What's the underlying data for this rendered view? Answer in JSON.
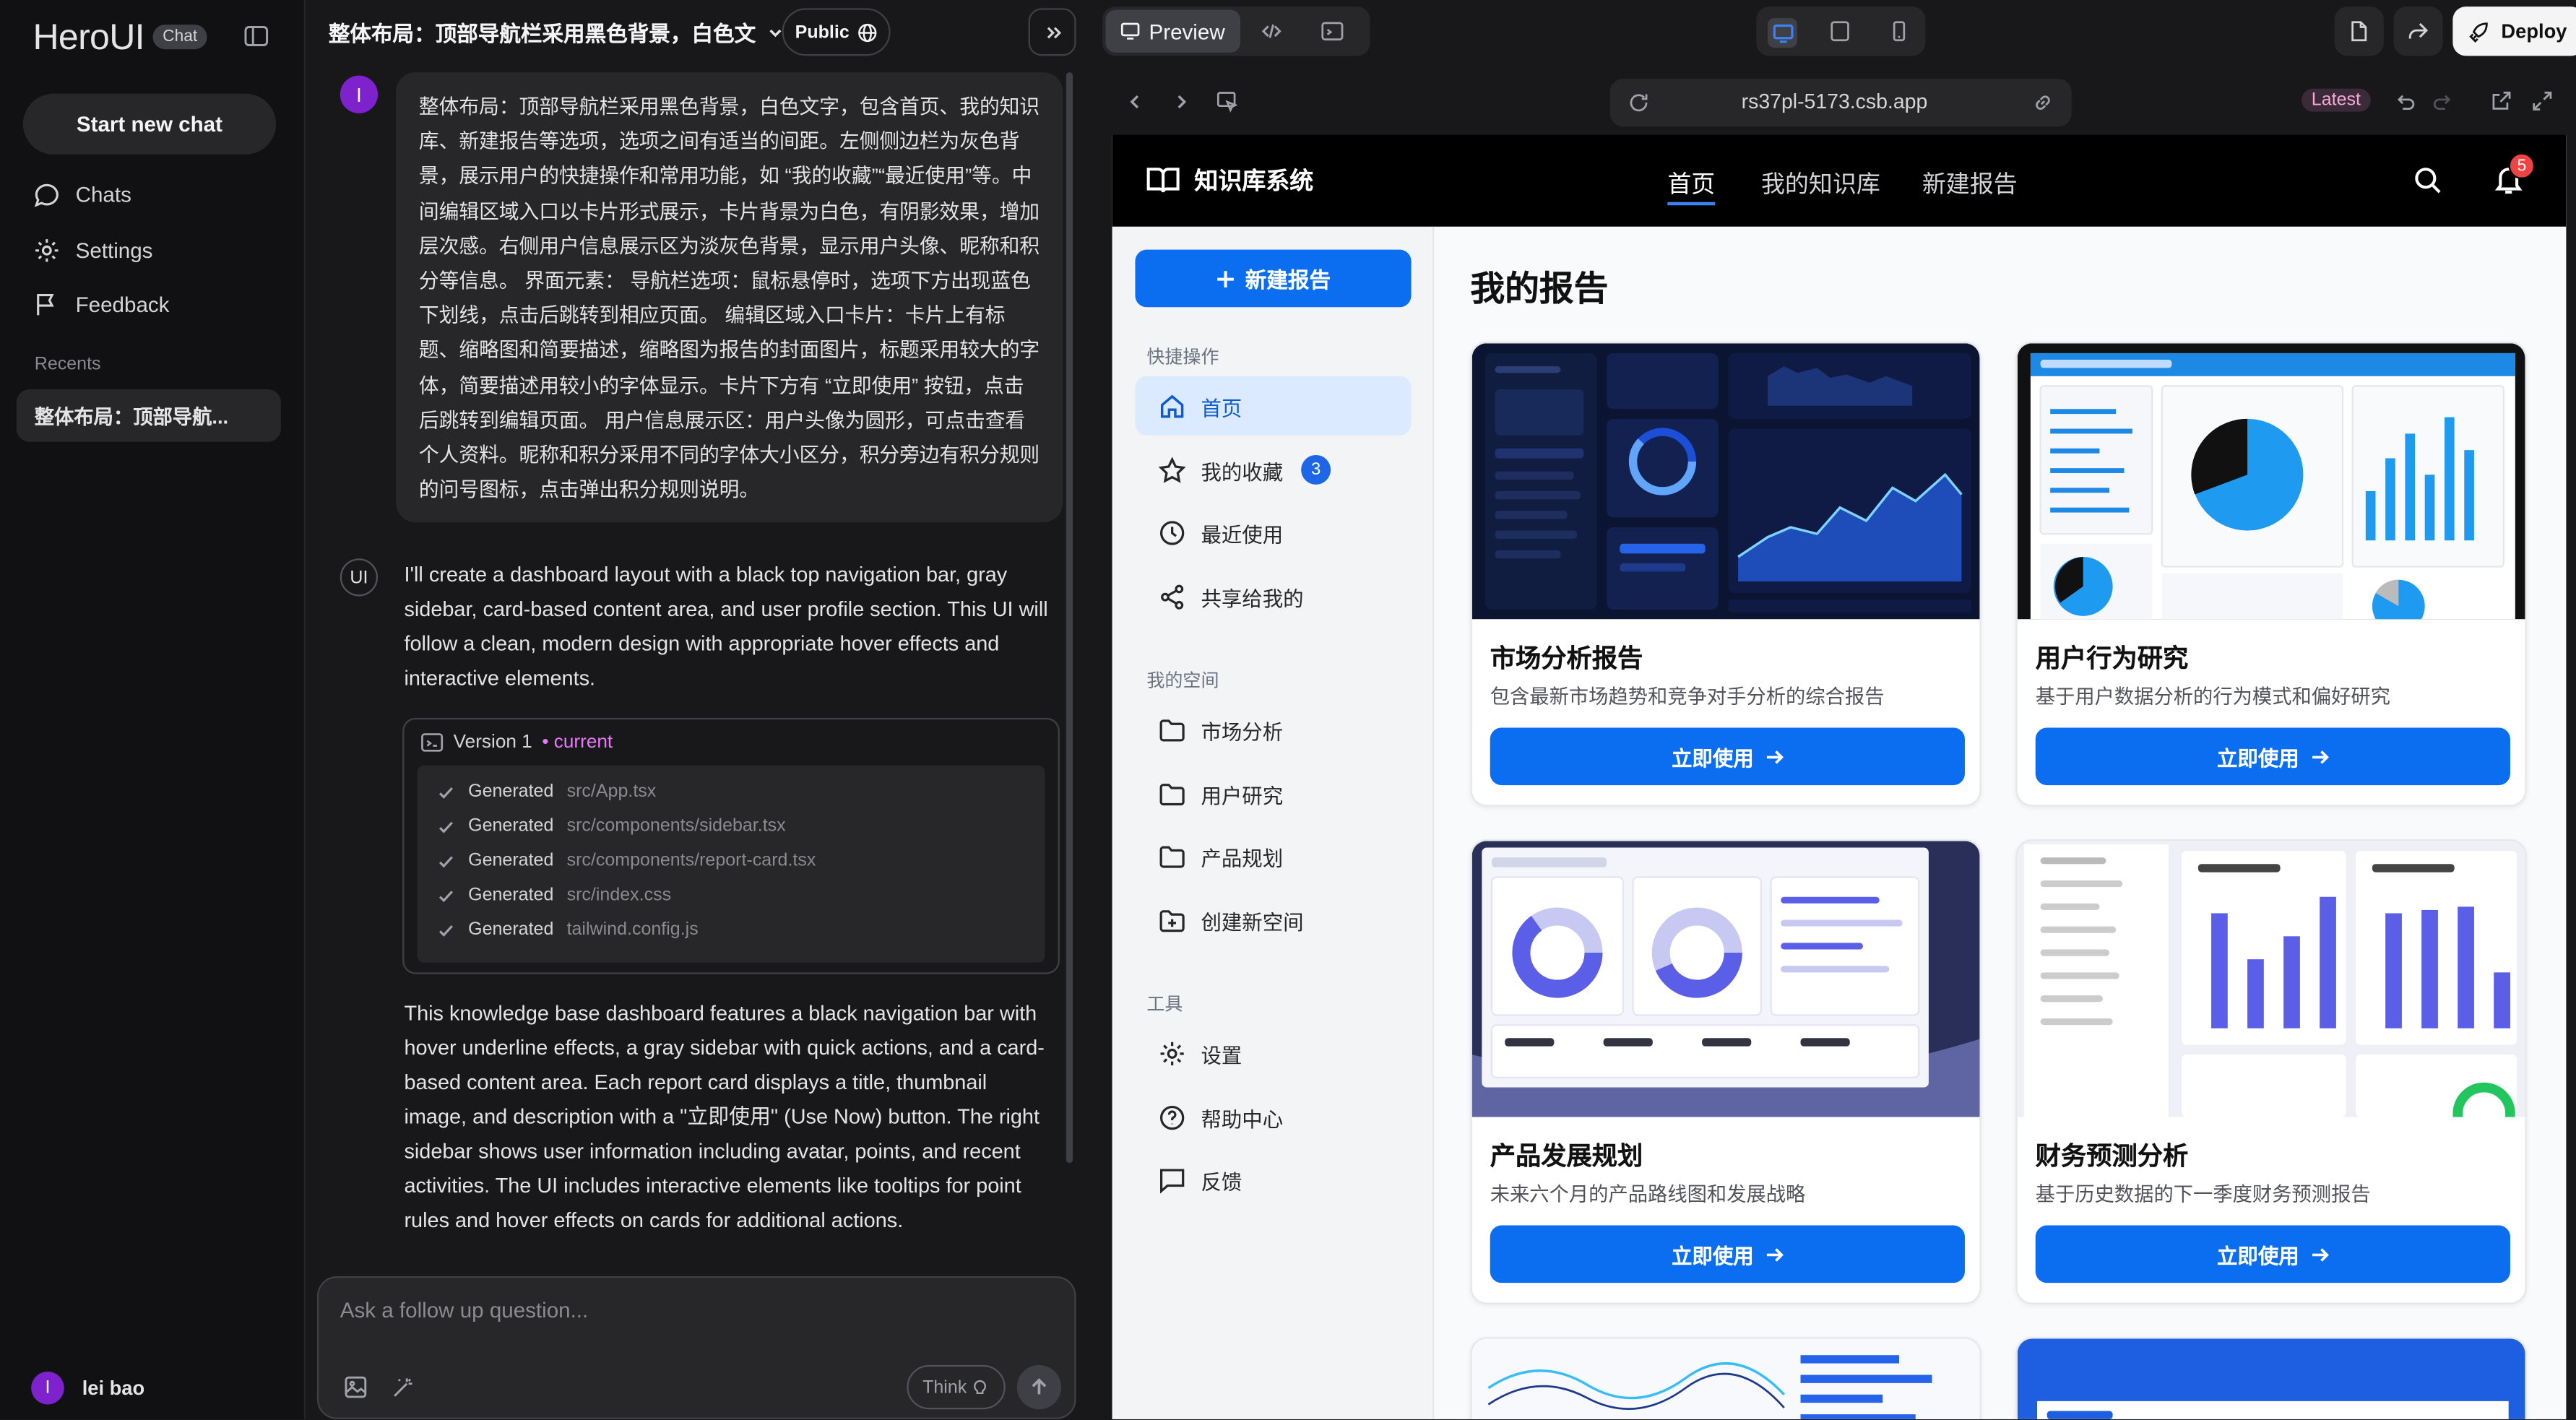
{
  "sidebar": {
    "logo": "HeroUI",
    "badge": "Chat",
    "new_chat": "Start new chat",
    "nav": [
      {
        "label": "Chats",
        "icon": "chat-bubble-icon"
      },
      {
        "label": "Settings",
        "icon": "gear-icon"
      },
      {
        "label": "Feedback",
        "icon": "flag-icon"
      }
    ],
    "recents_label": "Recents",
    "recent_item": "整体布局：顶部导航...",
    "user": {
      "initial": "I",
      "name": "lei bao"
    }
  },
  "chat": {
    "title": "整体布局：顶部导航栏采用黑色背景，白色文",
    "public_label": "Public",
    "user_avatar": "I",
    "user_message": "整体布局：顶部导航栏采用黑色背景，白色文字，包含首页、我的知识库、新建报告等选项，选项之间有适当的间距。左侧侧边栏为灰色背景，展示用户的快捷操作和常用功能，如 “我的收藏”“最近使用”等。中间编辑区域入口以卡片形式展示，卡片背景为白色，有阴影效果，增加层次感。右侧用户信息展示区为淡灰色背景，显示用户头像、昵称和积分等信息。 界面元素： 导航栏选项：鼠标悬停时，选项下方出现蓝色下划线，点击后跳转到相应页面。 编辑区域入口卡片：卡片上有标题、缩略图和简要描述，缩略图为报告的封面图片，标题采用较大的字体，简要描述用较小的字体显示。卡片下方有 “立即使用” 按钮，点击后跳转到编辑页面。 用户信息展示区：用户头像为圆形，可点击查看个人资料。昵称和积分采用不同的字体大小区分，积分旁边有积分规则的问号图标，点击弹出积分规则说明。",
    "ai_avatar": "UI",
    "ai_intro": "I'll create a dashboard layout with a black top navigation bar, gray sidebar, card-based content area, and user profile section. This UI will follow a clean, modern design with appropriate hover effects and interactive elements.",
    "version": {
      "label": "Version 1",
      "status": "• current"
    },
    "files": [
      {
        "action": "Generated",
        "path": "src/App.tsx"
      },
      {
        "action": "Generated",
        "path": "src/components/sidebar.tsx"
      },
      {
        "action": "Generated",
        "path": "src/components/report-card.tsx"
      },
      {
        "action": "Generated",
        "path": "src/index.css"
      },
      {
        "action": "Generated",
        "path": "tailwind.config.js"
      }
    ],
    "ai_summary": "This knowledge base dashboard features a black navigation bar with hover underline effects, a gray sidebar with quick actions, and a card-based content area. Each report card displays a title, thumbnail image, and description with a \"立即使用\" (Use Now) button. The right sidebar shows user information including avatar, points, and recent activities. The UI includes interactive elements like tooltips for point rules and hover effects on cards for additional actions.",
    "input_placeholder": "Ask a follow up question...",
    "think_label": "Think"
  },
  "toolbar": {
    "preview_label": "Preview",
    "deploy_label": "Deploy"
  },
  "browser": {
    "url": "rs37pl-5173.csb.app",
    "version_badge": "Latest"
  },
  "app": {
    "brand": "知识库系统",
    "nav": [
      "首页",
      "我的知识库",
      "新建报告"
    ],
    "notification_count": "5",
    "new_report": "新建报告",
    "quick_section": "快捷操作",
    "quick_items": [
      {
        "label": "首页",
        "icon": "home-icon"
      },
      {
        "label": "我的收藏",
        "icon": "star-icon",
        "count": "3"
      },
      {
        "label": "最近使用",
        "icon": "clock-icon"
      },
      {
        "label": "共享给我的",
        "icon": "share-icon"
      }
    ],
    "space_section": "我的空间",
    "space_items": [
      {
        "label": "市场分析",
        "icon": "folder-icon"
      },
      {
        "label": "用户研究",
        "icon": "folder-icon"
      },
      {
        "label": "产品规划",
        "icon": "folder-icon"
      },
      {
        "label": "创建新空间",
        "icon": "folder-plus-icon"
      }
    ],
    "tools_section": "工具",
    "tools_items": [
      {
        "label": "设置",
        "icon": "gear-icon"
      },
      {
        "label": "帮助中心",
        "icon": "help-circle-icon"
      },
      {
        "label": "反馈",
        "icon": "message-square-icon"
      }
    ],
    "main_title": "我的报告",
    "cards": [
      {
        "title": "市场分析报告",
        "desc": "包含最新市场趋势和竞争对手分析的综合报告",
        "button": "立即使用"
      },
      {
        "title": "用户行为研究",
        "desc": "基于用户数据分析的行为模式和偏好研究",
        "button": "立即使用"
      },
      {
        "title": "产品发展规划",
        "desc": "未来六个月的产品路线图和发展战略",
        "button": "立即使用"
      },
      {
        "title": "财务预测分析",
        "desc": "基于历史数据的下一季度财务预测报告",
        "button": "立即使用"
      }
    ]
  },
  "colors": {
    "accent": "#0b6ef0",
    "nav_bg": "#000000",
    "badge_red": "#ef4444",
    "purple_avatar": "#7e22ce"
  }
}
